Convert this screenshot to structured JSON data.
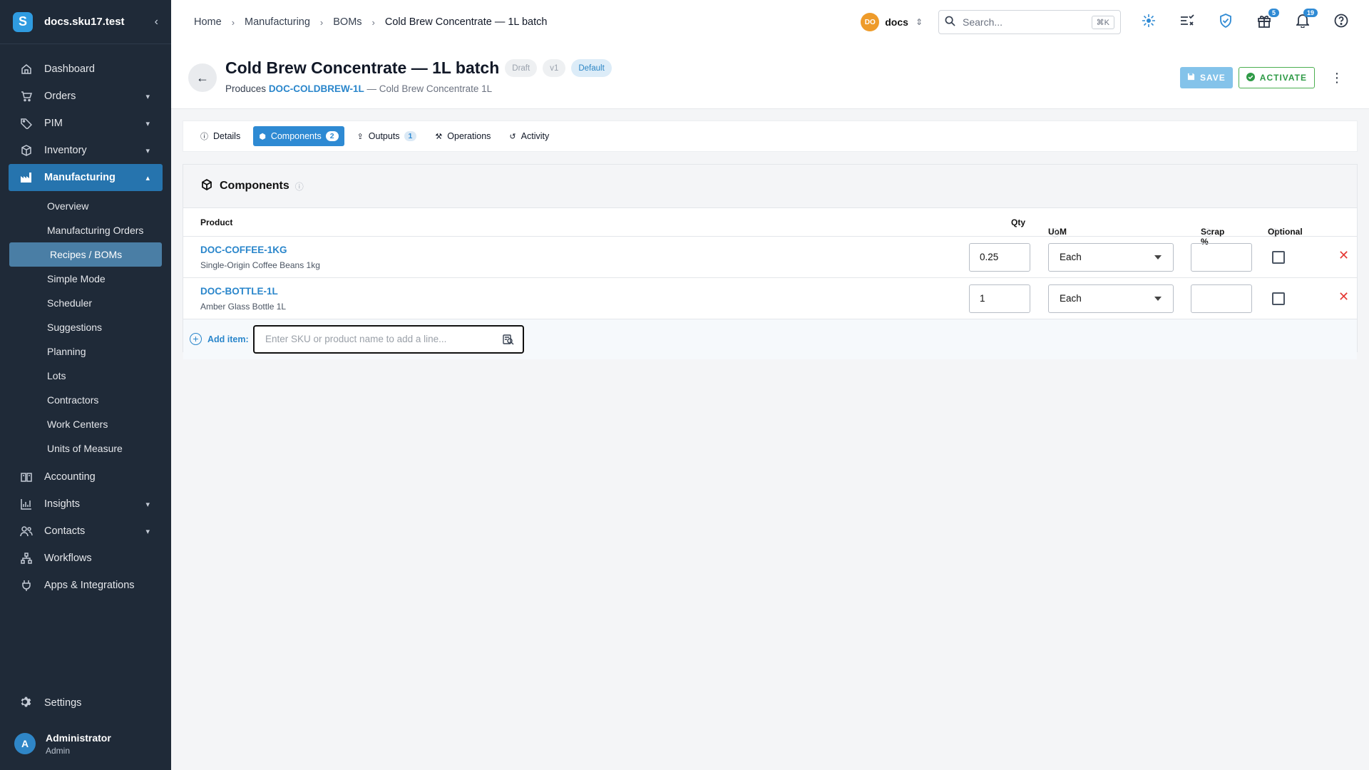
{
  "brand": {
    "name": "docs.sku17.test",
    "logo_letter": "S"
  },
  "sidebar": {
    "items": [
      {
        "label": "Dashboard",
        "icon": "home-icon"
      },
      {
        "label": "Orders",
        "icon": "cart-icon",
        "expandable": true
      },
      {
        "label": "PIM",
        "icon": "tag-icon",
        "expandable": true
      },
      {
        "label": "Inventory",
        "icon": "box-icon",
        "expandable": true
      },
      {
        "label": "Manufacturing",
        "icon": "factory-icon",
        "expanded": true,
        "active": true
      },
      {
        "label": "Accounting",
        "icon": "ledger-icon"
      },
      {
        "label": "Insights",
        "icon": "chart-icon",
        "expandable": true
      },
      {
        "label": "Contacts",
        "icon": "contacts-icon",
        "expandable": true
      },
      {
        "label": "Workflows",
        "icon": "workflow-icon"
      },
      {
        "label": "Apps & Integrations",
        "icon": "plug-icon"
      }
    ],
    "manufacturing_sub": [
      "Overview",
      "Manufacturing Orders",
      "Recipes / BOMs",
      "Simple Mode",
      "Scheduler",
      "Suggestions",
      "Planning",
      "Lots",
      "Contractors",
      "Work Centers",
      "Units of Measure"
    ],
    "active_sub": "Recipes / BOMs",
    "settings_label": "Settings",
    "user": {
      "initial": "A",
      "name": "Administrator",
      "role": "Admin"
    }
  },
  "topbar": {
    "breadcrumbs": [
      "Home",
      "Manufacturing",
      "BOMs",
      "Cold Brew Concentrate — 1L batch"
    ],
    "workspace": {
      "initials": "DO",
      "name": "docs"
    },
    "search": {
      "placeholder": "Search...",
      "shortcut": "⌘K"
    },
    "gift_count": "5",
    "notification_count": "19"
  },
  "page": {
    "title": "Cold Brew Concentrate — 1L batch",
    "status": "Draft",
    "version": "v1",
    "default_label": "Default",
    "produces_label": "Produces",
    "produces_sku": "DOC-COLDBREW-1L",
    "produces_name": "— Cold Brew Concentrate 1L",
    "save_label": "SAVE",
    "activate_label": "ACTIVATE"
  },
  "tabs": [
    {
      "label": "Details",
      "icon": "info-icon"
    },
    {
      "label": "Components",
      "icon": "cube-icon",
      "count": "2",
      "active": true
    },
    {
      "label": "Outputs",
      "icon": "upload-icon",
      "count": "1"
    },
    {
      "label": "Operations",
      "icon": "tools-icon"
    },
    {
      "label": "Activity",
      "icon": "history-icon"
    }
  ],
  "components": {
    "title": "Components",
    "columns": {
      "product": "Product",
      "qty": "Qty",
      "uom": "UoM",
      "scrap": "Scrap %",
      "optional": "Optional"
    },
    "rows": [
      {
        "sku": "DOC-COFFEE-1KG",
        "name": "Single-Origin Coffee Beans 1kg",
        "qty": "0.25",
        "uom": "Each",
        "scrap": "",
        "optional": false
      },
      {
        "sku": "DOC-BOTTLE-1L",
        "name": "Amber Glass Bottle 1L",
        "qty": "1",
        "uom": "Each",
        "scrap": "",
        "optional": false
      }
    ],
    "add_label": "Add item:",
    "add_placeholder": "Enter SKU or product name to add a line..."
  },
  "colors": {
    "sidebar_bg": "#1f2a38",
    "accent": "#2e8ad3",
    "activate_green": "#2e9a46",
    "delete_red": "#e53935"
  }
}
